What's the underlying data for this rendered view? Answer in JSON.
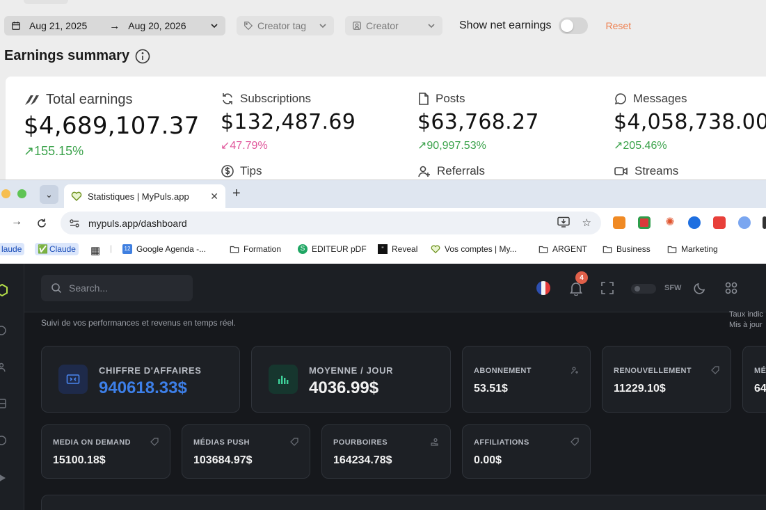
{
  "filters": {
    "date_from": "Aug 21, 2025",
    "date_to": "Aug 20, 2026",
    "creator_tag": "Creator tag",
    "creator": "Creator",
    "net_label": "Show net earnings",
    "reset": "Reset"
  },
  "summary": {
    "title": "Earnings summary",
    "total": {
      "label": "Total earnings",
      "value": "$4,689,107.37",
      "change": "155.15%"
    },
    "subscriptions": {
      "label": "Subscriptions",
      "value": "$132,487.69",
      "change": "47.79%"
    },
    "posts": {
      "label": "Posts",
      "value": "$63,768.27",
      "change": "90,997.53%"
    },
    "messages": {
      "label": "Messages",
      "value": "$4,058,738.00",
      "change": "205.46%"
    },
    "tips": {
      "label": "Tips"
    },
    "referrals": {
      "label": "Referrals"
    },
    "streams": {
      "label": "Streams"
    }
  },
  "browser": {
    "tab_title": "Statistiques | MyPuls.app",
    "url": "mypuls.app/dashboard",
    "bookmarks": {
      "claude_cut": "laude",
      "claude": "Claude",
      "agenda": "Google Agenda -...",
      "formation": "Formation",
      "editeur": "EDITEUR pDF",
      "reveal": "Reveal",
      "comptes": "Vos comptes | My...",
      "argent": "ARGENT",
      "business": "Business",
      "marketing": "Marketing"
    }
  },
  "dashboard": {
    "search_placeholder": "Search...",
    "notifications": "4",
    "sfw": "SFW",
    "subtitle": "Suivi de vos performances et revenus en temps réel.",
    "taux_line1": "Taux indic",
    "taux_line2": "Mis à jour",
    "cards": {
      "ca": {
        "label": "CHIFFRE D'AFFAIRES",
        "value": "940618.33$"
      },
      "moyenne": {
        "label": "MOYENNE / JOUR",
        "value": "4036.99$"
      },
      "abonnement": {
        "label": "ABONNEMENT",
        "value": "53.51$"
      },
      "renouvellement": {
        "label": "RENOUVELLEMENT",
        "value": "11229.10$"
      },
      "cut_label": "MÉ",
      "cut_value": "64",
      "mod": {
        "label": "MEDIA ON DEMAND",
        "value": "15100.18$"
      },
      "push": {
        "label": "MÉDIAS PUSH",
        "value": "103684.97$"
      },
      "pourboires": {
        "label": "POURBOIRES",
        "value": "164234.78$"
      },
      "affiliations": {
        "label": "AFFILIATIONS",
        "value": "0.00$"
      }
    }
  },
  "colors": {
    "accent_blue": "#3d7fe8",
    "positive": "#3aa24a",
    "negative": "#e0559a",
    "reset": "#ee8050",
    "badge": "#e0604a"
  }
}
